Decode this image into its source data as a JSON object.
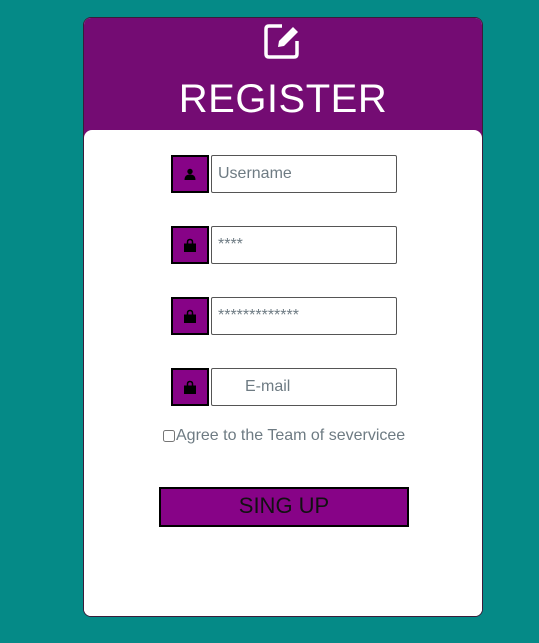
{
  "header": {
    "title": "REGISTER",
    "icon": "edit-icon"
  },
  "form": {
    "username": {
      "placeholder": "Username",
      "icon": "user-icon"
    },
    "password": {
      "placeholder": "****",
      "icon": "lock-icon"
    },
    "confirm_password": {
      "placeholder": "*************",
      "icon": "lock-icon"
    },
    "email": {
      "placeholder": "E-mail",
      "icon": "lock-icon"
    },
    "agree_label": "Agree to the Team of severvicee",
    "submit_label": "SING UP"
  },
  "colors": {
    "background": "#058a87",
    "header": "#740c73",
    "accent": "#870387"
  }
}
